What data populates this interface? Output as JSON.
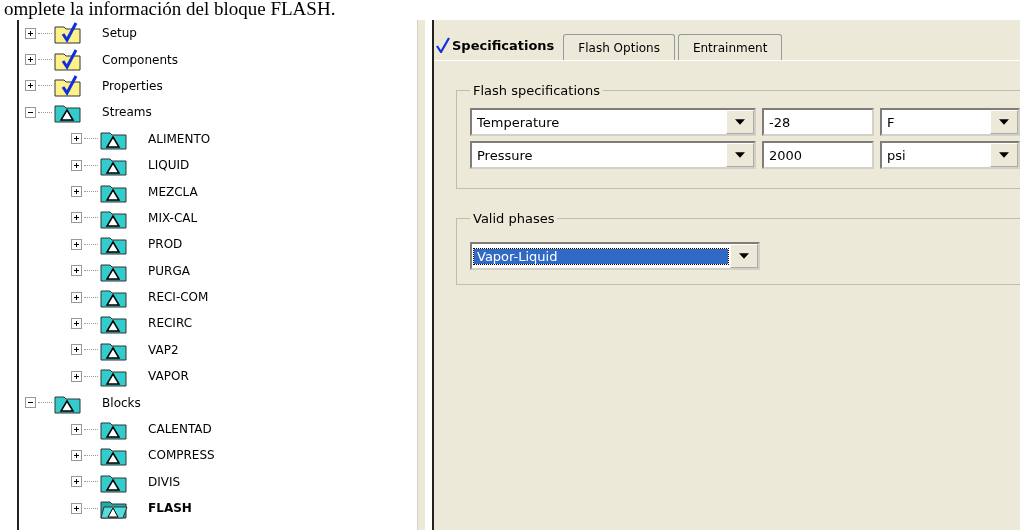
{
  "document_text": "omplete la información del bloque FLASH.",
  "tree": [
    {
      "label": "Setup",
      "kind": "check",
      "expanded": false,
      "selected": false
    },
    {
      "label": "Components",
      "kind": "check",
      "expanded": false,
      "selected": false
    },
    {
      "label": "Properties",
      "kind": "check",
      "expanded": false,
      "selected": false
    },
    {
      "label": "Streams",
      "kind": "triangle",
      "expanded": true,
      "selected": false,
      "children": [
        {
          "label": "ALIMENTO",
          "kind": "triangle",
          "expanded": false,
          "selected": false
        },
        {
          "label": "LIQUID",
          "kind": "triangle",
          "expanded": false,
          "selected": false
        },
        {
          "label": "MEZCLA",
          "kind": "triangle",
          "expanded": false,
          "selected": false
        },
        {
          "label": "MIX-CAL",
          "kind": "triangle",
          "expanded": false,
          "selected": false
        },
        {
          "label": "PROD",
          "kind": "triangle",
          "expanded": false,
          "selected": false
        },
        {
          "label": "PURGA",
          "kind": "triangle",
          "expanded": false,
          "selected": false
        },
        {
          "label": "RECI-COM",
          "kind": "triangle",
          "expanded": false,
          "selected": false
        },
        {
          "label": "RECIRC",
          "kind": "triangle",
          "expanded": false,
          "selected": false
        },
        {
          "label": "VAP2",
          "kind": "triangle",
          "expanded": false,
          "selected": false
        },
        {
          "label": "VAPOR",
          "kind": "triangle",
          "expanded": false,
          "selected": false
        }
      ]
    },
    {
      "label": "Blocks",
      "kind": "triangle",
      "expanded": true,
      "selected": false,
      "children": [
        {
          "label": "CALENTAD",
          "kind": "triangle",
          "expanded": false,
          "selected": false
        },
        {
          "label": "COMPRESS",
          "kind": "triangle",
          "expanded": false,
          "selected": false
        },
        {
          "label": "DIVIS",
          "kind": "triangle",
          "expanded": false,
          "selected": false
        },
        {
          "label": "FLASH",
          "kind": "open",
          "expanded": false,
          "selected": true
        }
      ]
    }
  ],
  "tabs": [
    {
      "label": "Specifications",
      "selected": true,
      "complete": true
    },
    {
      "label": "Flash Options",
      "selected": false,
      "complete": false
    },
    {
      "label": "Entrainment",
      "selected": false,
      "complete": false
    }
  ],
  "flash_specifications": {
    "title": "Flash specifications",
    "rows": [
      {
        "variable": "Temperature",
        "value": "-28",
        "unit": "F"
      },
      {
        "variable": "Pressure",
        "value": "2000",
        "unit": "psi"
      }
    ]
  },
  "valid_phases": {
    "title": "Valid phases",
    "value": "Vapor-Liquid",
    "selected": true
  }
}
